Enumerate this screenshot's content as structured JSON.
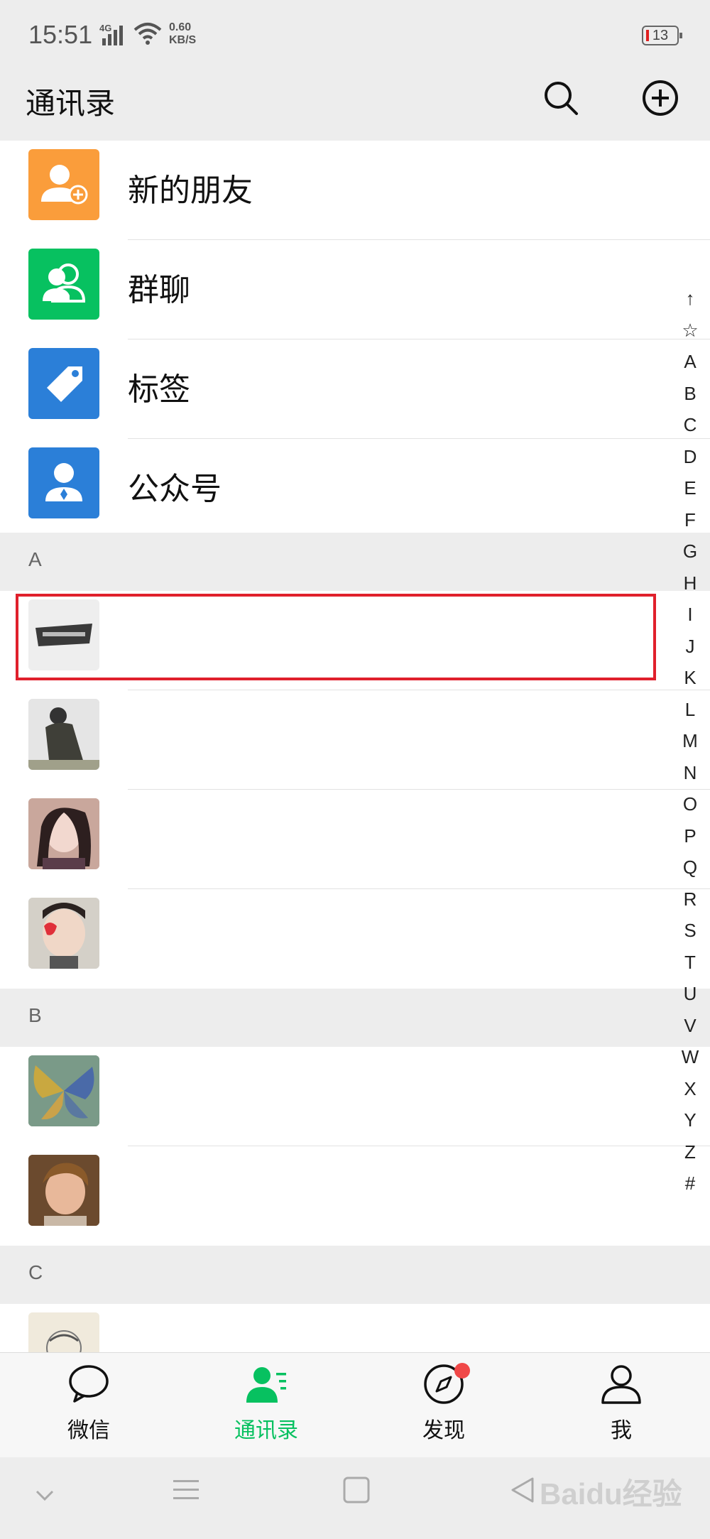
{
  "status_bar": {
    "time": "15:51",
    "network": "4G",
    "speed_value": "0.60",
    "speed_unit": "KB/S",
    "battery": "13"
  },
  "header": {
    "title": "通讯录"
  },
  "fixed_items": [
    {
      "label": "新的朋友",
      "icon": "add-friend-icon",
      "color": "#fa9d3b"
    },
    {
      "label": "群聊",
      "icon": "group-chat-icon",
      "color": "#07c160"
    },
    {
      "label": "标签",
      "icon": "tag-icon",
      "color": "#2b7fd8"
    },
    {
      "label": "公众号",
      "icon": "official-account-icon",
      "color": "#2b7fd8"
    }
  ],
  "sections": [
    {
      "letter": "A",
      "contacts": 4
    },
    {
      "letter": "B",
      "contacts": 2
    },
    {
      "letter": "C",
      "contacts": 1
    }
  ],
  "index": [
    "↑",
    "☆",
    "A",
    "B",
    "C",
    "D",
    "E",
    "F",
    "G",
    "H",
    "I",
    "J",
    "K",
    "L",
    "M",
    "N",
    "O",
    "P",
    "Q",
    "R",
    "S",
    "T",
    "U",
    "V",
    "W",
    "X",
    "Y",
    "Z",
    "#"
  ],
  "tabs": [
    {
      "label": "微信",
      "icon": "chat-bubble-icon",
      "active": false
    },
    {
      "label": "通讯录",
      "icon": "contacts-icon",
      "active": true
    },
    {
      "label": "发现",
      "icon": "compass-icon",
      "active": false
    },
    {
      "label": "我",
      "icon": "profile-icon",
      "active": false
    }
  ],
  "watermark": "Baidu经验",
  "colors": {
    "accent": "#07c160",
    "highlight": "#e0202c",
    "badge": "#f04848"
  }
}
